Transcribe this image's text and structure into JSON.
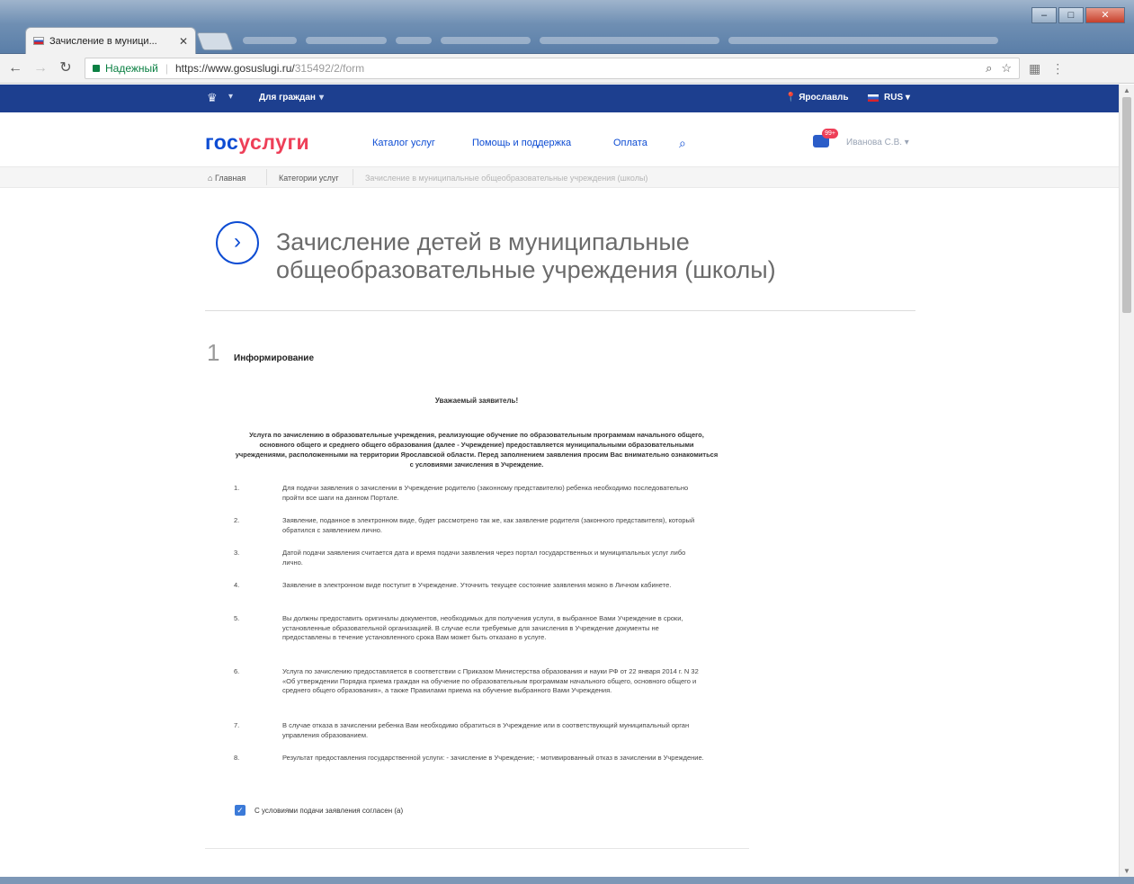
{
  "browser": {
    "tab_title": "Зачисление в муници...",
    "tab_close": "✕",
    "secure_label": "Надежный",
    "url_host": "https://www.gosuslugi.ru/",
    "url_path": "315492/2/form"
  },
  "gs_top": {
    "emblem": "♛",
    "caret": "▾",
    "for_citizens": "Для граждан",
    "region": "Ярославль",
    "lang": "RUS"
  },
  "header": {
    "logo_part1": "гос",
    "logo_part2": "услуги",
    "menu": [
      "Каталог услуг",
      "Помощь и поддержка",
      "Оплата"
    ],
    "notif_badge": "99+",
    "user_name": "Иванова С.В. ▾"
  },
  "breadcrumbs": [
    "Главная",
    "Категории услуг",
    "Зачисление в муниципальные общеобразовательные учреждения (школы)"
  ],
  "page": {
    "title_icon": "›",
    "title": "Зачисление детей в муниципальные общеобразовательные учреждения (школы)",
    "step_number": "1",
    "step_title": "Информирование",
    "greeting": "Уважаемый заявитель!",
    "intro": "Услуга по зачислению в образовательные учреждения, реализующие обучение по образовательным программам начального общего, основного общего и среднего общего образования (далее - Учреждение) предоставляется муниципальными образовательными учреждениями, расположенными на территории Ярославской области. Перед заполнением заявления просим Вас внимательно ознакомиться с условиями зачисления в Учреждение.",
    "items": [
      {
        "num": "1.",
        "text": "Для подачи заявления о зачислении в Учреждение родителю (законному представителю) ребенка необходимо последовательно пройти все шаги на данном Портале."
      },
      {
        "num": "2.",
        "text": "Заявление, поданное в электронном виде, будет рассмотрено так же, как заявление родителя (законного представителя), который обратился с заявлением лично."
      },
      {
        "num": "3.",
        "text": "Датой подачи заявления считается дата и время подачи заявления через портал государственных и муниципальных услуг либо лично."
      },
      {
        "num": "4.",
        "text": "Заявление в электронном виде поступит в Учреждение. Уточнить текущее состояние заявления можно в Личном кабинете."
      },
      {
        "num": "5.",
        "text": "Вы должны предоставить оригиналы документов, необходимых для получения услуги, в выбранное Вами Учреждение в сроки, установленные образовательной организацией. В случае если требуемые для зачисления в Учреждение документы не предоставлены в течение установленного срока Вам может быть отказано в услуге."
      },
      {
        "num": "6.",
        "text": "Услуга по зачислению предоставляется в соответствии с Приказом Министерства образования и науки РФ от 22 января 2014 г. N 32 «Об утверждении Порядка приема граждан на обучение по образовательным программам начального общего, основного общего и среднего общего образования», а также Правилами приема на обучение выбранного Вами Учреждения."
      },
      {
        "num": "7.",
        "text": "В случае отказа в зачислении ребенка Вам необходимо обратиться в Учреждение или в соответствующий муниципальный орган управления образованием."
      },
      {
        "num": "8.",
        "text": "Результат предоставления государственной услуги: - зачисление в Учреждение; - мотивированный отказ в зачислении в Учреждение."
      }
    ],
    "agree_check": "✓",
    "agree_label": "С условиями подачи заявления согласен (а)"
  }
}
